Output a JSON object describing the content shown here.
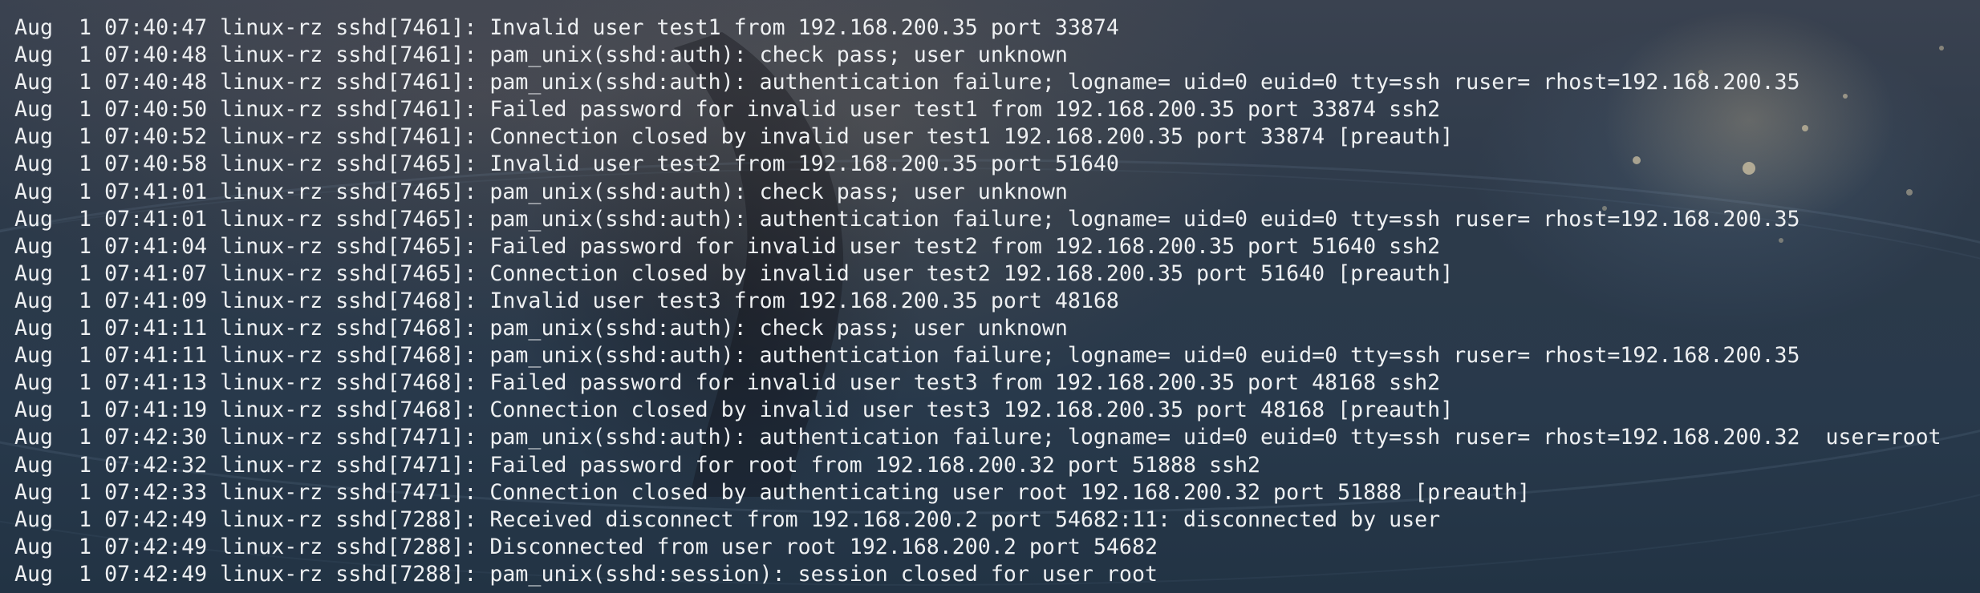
{
  "terminal": {
    "lines": [
      "Aug  1 07:40:47 linux-rz sshd[7461]: Invalid user test1 from 192.168.200.35 port 33874",
      "Aug  1 07:40:48 linux-rz sshd[7461]: pam_unix(sshd:auth): check pass; user unknown",
      "Aug  1 07:40:48 linux-rz sshd[7461]: pam_unix(sshd:auth): authentication failure; logname= uid=0 euid=0 tty=ssh ruser= rhost=192.168.200.35",
      "Aug  1 07:40:50 linux-rz sshd[7461]: Failed password for invalid user test1 from 192.168.200.35 port 33874 ssh2",
      "Aug  1 07:40:52 linux-rz sshd[7461]: Connection closed by invalid user test1 192.168.200.35 port 33874 [preauth]",
      "Aug  1 07:40:58 linux-rz sshd[7465]: Invalid user test2 from 192.168.200.35 port 51640",
      "Aug  1 07:41:01 linux-rz sshd[7465]: pam_unix(sshd:auth): check pass; user unknown",
      "Aug  1 07:41:01 linux-rz sshd[7465]: pam_unix(sshd:auth): authentication failure; logname= uid=0 euid=0 tty=ssh ruser= rhost=192.168.200.35",
      "Aug  1 07:41:04 linux-rz sshd[7465]: Failed password for invalid user test2 from 192.168.200.35 port 51640 ssh2",
      "Aug  1 07:41:07 linux-rz sshd[7465]: Connection closed by invalid user test2 192.168.200.35 port 51640 [preauth]",
      "Aug  1 07:41:09 linux-rz sshd[7468]: Invalid user test3 from 192.168.200.35 port 48168",
      "Aug  1 07:41:11 linux-rz sshd[7468]: pam_unix(sshd:auth): check pass; user unknown",
      "Aug  1 07:41:11 linux-rz sshd[7468]: pam_unix(sshd:auth): authentication failure; logname= uid=0 euid=0 tty=ssh ruser= rhost=192.168.200.35",
      "Aug  1 07:41:13 linux-rz sshd[7468]: Failed password for invalid user test3 from 192.168.200.35 port 48168 ssh2",
      "Aug  1 07:41:19 linux-rz sshd[7468]: Connection closed by invalid user test3 192.168.200.35 port 48168 [preauth]",
      "Aug  1 07:42:30 linux-rz sshd[7471]: pam_unix(sshd:auth): authentication failure; logname= uid=0 euid=0 tty=ssh ruser= rhost=192.168.200.32  user=root",
      "Aug  1 07:42:32 linux-rz sshd[7471]: Failed password for root from 192.168.200.32 port 51888 ssh2",
      "Aug  1 07:42:33 linux-rz sshd[7471]: Connection closed by authenticating user root 192.168.200.32 port 51888 [preauth]",
      "Aug  1 07:42:49 linux-rz sshd[7288]: Received disconnect from 192.168.200.2 port 54682:11: disconnected by user",
      "Aug  1 07:42:49 linux-rz sshd[7288]: Disconnected from user root 192.168.200.2 port 54682",
      "Aug  1 07:42:49 linux-rz sshd[7288]: pam_unix(sshd:session): session closed for user root"
    ]
  },
  "colors": {
    "text": "#eef0f2",
    "background": "#28394b"
  }
}
